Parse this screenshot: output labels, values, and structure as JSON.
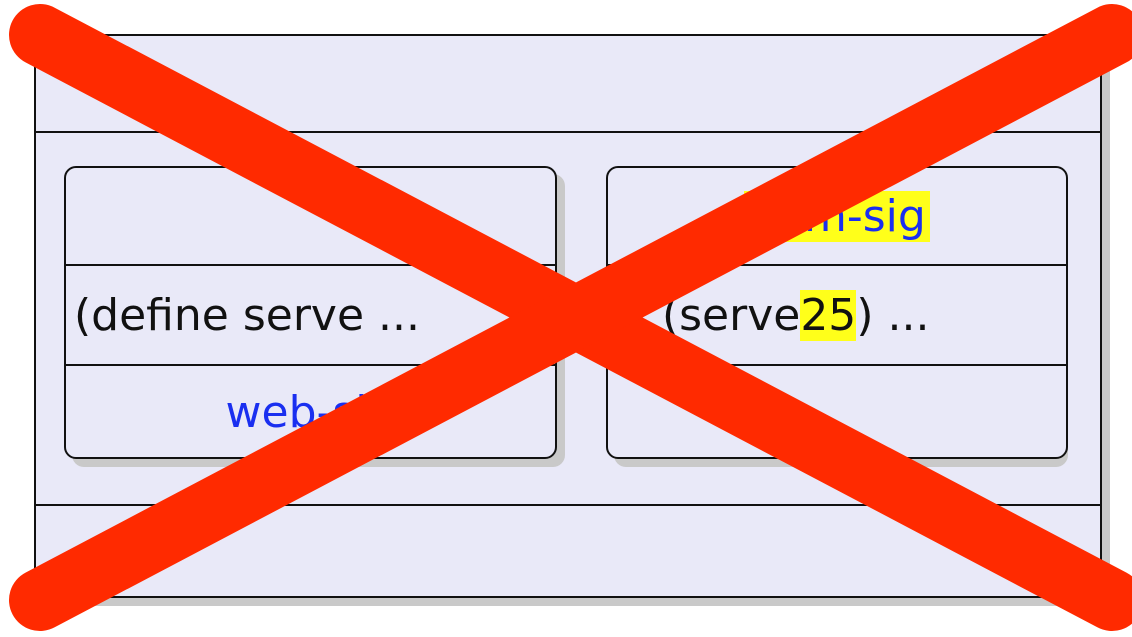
{
  "diagram": {
    "left_unit": {
      "import_sig": "",
      "code": "(define serve ...",
      "export_sig": "web-sig"
    },
    "right_unit": {
      "import_sig": "num-sig",
      "code_prefix": "... (serve ",
      "code_arg": "25",
      "code_suffix": ") ...",
      "export_sig": ""
    },
    "colors": {
      "background": "#e9e9f8",
      "signature_text": "#1a2ff0",
      "highlight": "#ffff1a",
      "cross": "#ff2a00"
    }
  }
}
